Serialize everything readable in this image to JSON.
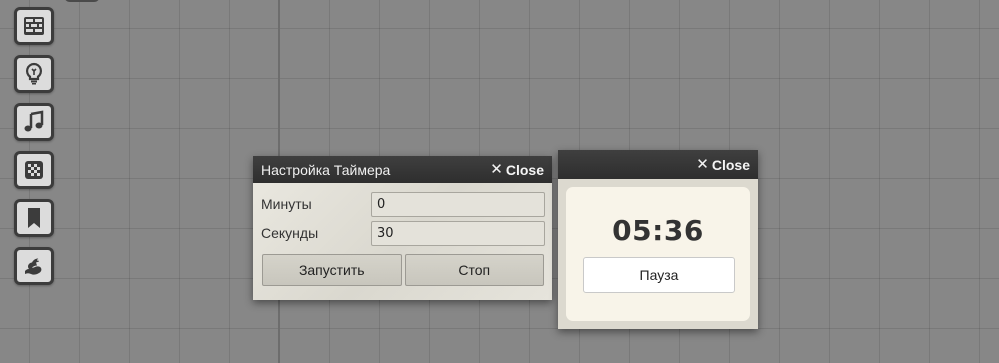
{
  "toolbar": {
    "items": [
      {
        "name": "map-tiles",
        "icon": "brick-wall-icon"
      },
      {
        "name": "light",
        "icon": "lightbulb-icon"
      },
      {
        "name": "music",
        "icon": "music-note-icon"
      },
      {
        "name": "dice",
        "icon": "checkered-die-icon"
      },
      {
        "name": "bookmark",
        "icon": "bookmark-icon"
      },
      {
        "name": "dragon",
        "icon": "dragon-icon"
      }
    ]
  },
  "settings_dialog": {
    "title": "Настройка Таймера",
    "close_label": "Close",
    "minutes_label": "Минуты",
    "minutes_value": "0",
    "seconds_label": "Секунды",
    "seconds_value": "30",
    "start_label": "Запустить",
    "stop_label": "Стоп"
  },
  "timer_dialog": {
    "close_label": "Close",
    "time": "05:36",
    "pause_label": "Пауза"
  },
  "colors": {
    "canvas": "#878787",
    "titlebar": "#333333",
    "panel": "#e2e0d8",
    "card": "#f8f4e9"
  }
}
